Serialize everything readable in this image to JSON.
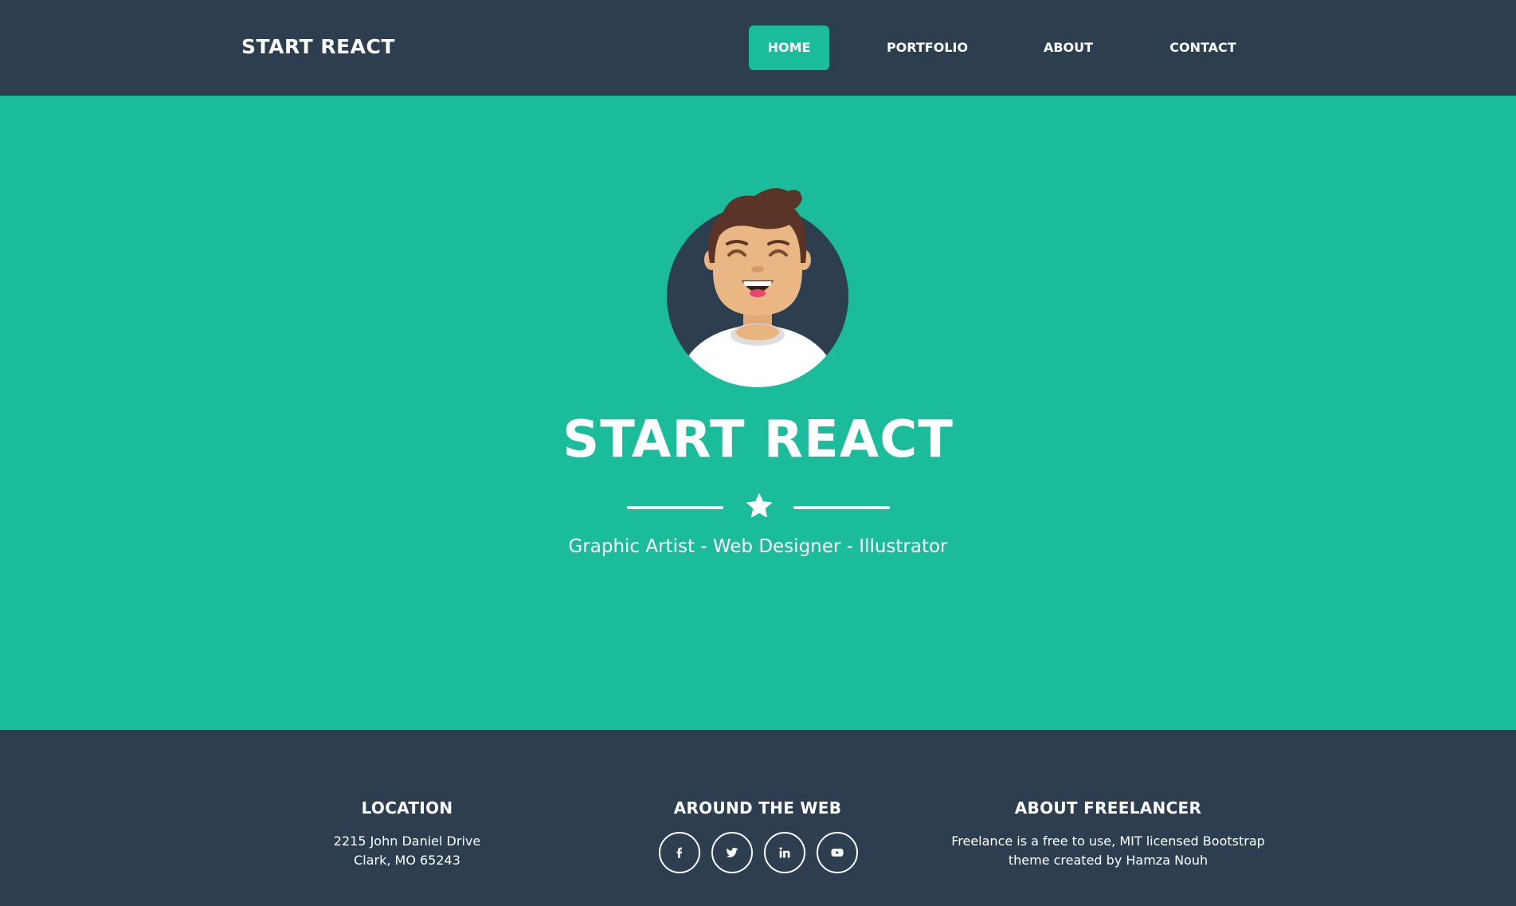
{
  "navbar": {
    "brand": "START REACT",
    "items": [
      {
        "label": "HOME",
        "active": true
      },
      {
        "label": "PORTFOLIO",
        "active": false
      },
      {
        "label": "ABOUT",
        "active": false
      },
      {
        "label": "CONTACT",
        "active": false
      }
    ]
  },
  "hero": {
    "avatar_icon": "smiling-man-avatar",
    "title": "START REACT",
    "divider_icon": "star-icon",
    "subtitle": "Graphic Artist - Web Designer - Illustrator"
  },
  "footer": {
    "location": {
      "heading": "LOCATION",
      "line1": "2215 John Daniel Drive",
      "line2": "Clark, MO 65243"
    },
    "web": {
      "heading": "AROUND THE WEB",
      "icons": [
        "facebook-icon",
        "twitter-icon",
        "linkedin-icon",
        "youtube-icon"
      ]
    },
    "about": {
      "heading": "ABOUT FREELANCER",
      "line1": "Freelance is a free to use, MIT licensed Bootstrap",
      "line2": "theme created by Hamza Nouh"
    }
  },
  "colors": {
    "dark": "#2c3e50",
    "accent": "#1abc9c",
    "text": "#ffffff"
  }
}
